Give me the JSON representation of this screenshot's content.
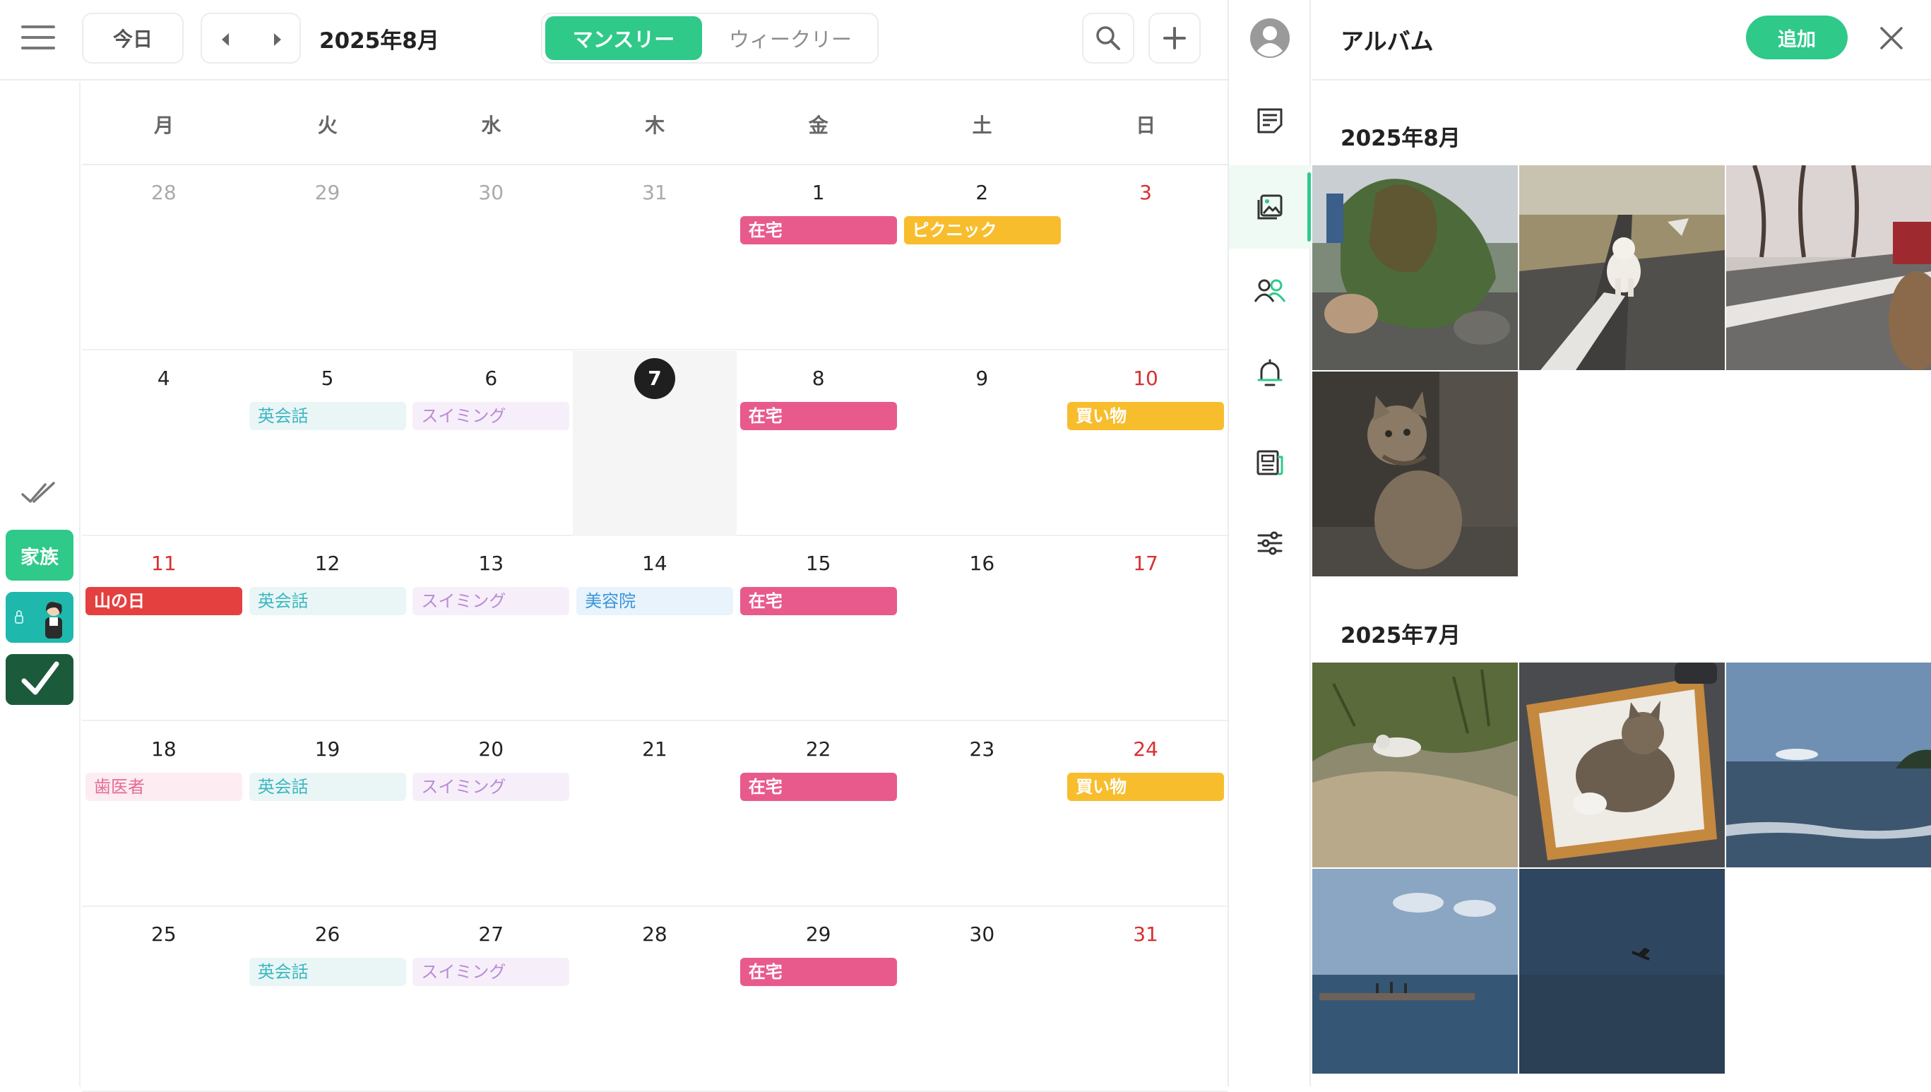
{
  "topbar": {
    "today_label": "今日",
    "month_title": "2025年8月",
    "view_monthly": "マンスリー",
    "view_weekly": "ウィークリー"
  },
  "sidebar": {
    "calendars": [
      {
        "label": "家族"
      }
    ]
  },
  "calendar": {
    "weekdays": [
      "月",
      "火",
      "水",
      "木",
      "金",
      "土",
      "日"
    ],
    "weeks": [
      {
        "days": [
          "28",
          "29",
          "30",
          "31",
          "1",
          "2",
          "3"
        ]
      },
      {
        "days": [
          "4",
          "5",
          "6",
          "7",
          "8",
          "9",
          "10"
        ]
      },
      {
        "days": [
          "11",
          "12",
          "13",
          "14",
          "15",
          "16",
          "17"
        ]
      },
      {
        "days": [
          "18",
          "19",
          "20",
          "21",
          "22",
          "23",
          "24"
        ]
      },
      {
        "days": [
          "25",
          "26",
          "27",
          "28",
          "29",
          "30",
          "31"
        ]
      }
    ],
    "events": [
      {
        "week": 0,
        "day": 4,
        "label": "在宅",
        "style": "ev-solid ev-pink"
      },
      {
        "week": 0,
        "day": 5,
        "label": "ピクニック",
        "style": "ev-solid ev-yellow"
      },
      {
        "week": 1,
        "day": 1,
        "label": "英会話",
        "style": "ev-eng"
      },
      {
        "week": 1,
        "day": 2,
        "label": "スイミング",
        "style": "ev-swim"
      },
      {
        "week": 1,
        "day": 4,
        "label": "在宅",
        "style": "ev-solid ev-pink"
      },
      {
        "week": 1,
        "day": 6,
        "label": "買い物",
        "style": "ev-solid ev-yellow"
      },
      {
        "week": 2,
        "day": 0,
        "label": "山の日",
        "style": "ev-solid ev-red"
      },
      {
        "week": 2,
        "day": 1,
        "label": "英会話",
        "style": "ev-eng"
      },
      {
        "week": 2,
        "day": 2,
        "label": "スイミング",
        "style": "ev-swim"
      },
      {
        "week": 2,
        "day": 3,
        "label": "美容院",
        "style": "ev-beauty"
      },
      {
        "week": 2,
        "day": 4,
        "label": "在宅",
        "style": "ev-solid ev-pink"
      },
      {
        "week": 3,
        "day": 0,
        "label": "歯医者",
        "style": "ev-dentist"
      },
      {
        "week": 3,
        "day": 1,
        "label": "英会話",
        "style": "ev-eng"
      },
      {
        "week": 3,
        "day": 2,
        "label": "スイミング",
        "style": "ev-swim"
      },
      {
        "week": 3,
        "day": 4,
        "label": "在宅",
        "style": "ev-solid ev-pink"
      },
      {
        "week": 3,
        "day": 6,
        "label": "買い物",
        "style": "ev-solid ev-yellow"
      },
      {
        "week": 4,
        "day": 1,
        "label": "英会話",
        "style": "ev-eng"
      },
      {
        "week": 4,
        "day": 2,
        "label": "スイミング",
        "style": "ev-swim"
      },
      {
        "week": 4,
        "day": 4,
        "label": "在宅",
        "style": "ev-solid ev-pink"
      }
    ]
  },
  "album": {
    "title": "アルバム",
    "add_label": "追加",
    "sections": [
      {
        "title": "2025年8月",
        "photos": [
          "dog-by-bush-photo",
          "dog-on-road-photo",
          "cherry-tree-road-photo",
          "tabby-cat-photo"
        ]
      },
      {
        "title": "2025年7月",
        "photos": [
          "cat-in-dunes-photo",
          "cat-in-hammock-photo",
          "sea-horizon-photo",
          "pier-photo",
          "bird-over-sea-photo"
        ]
      }
    ]
  },
  "colors": {
    "accent_green": "#2fc98a",
    "sunday_red": "#d83030",
    "today_black": "#1f1f1f"
  }
}
